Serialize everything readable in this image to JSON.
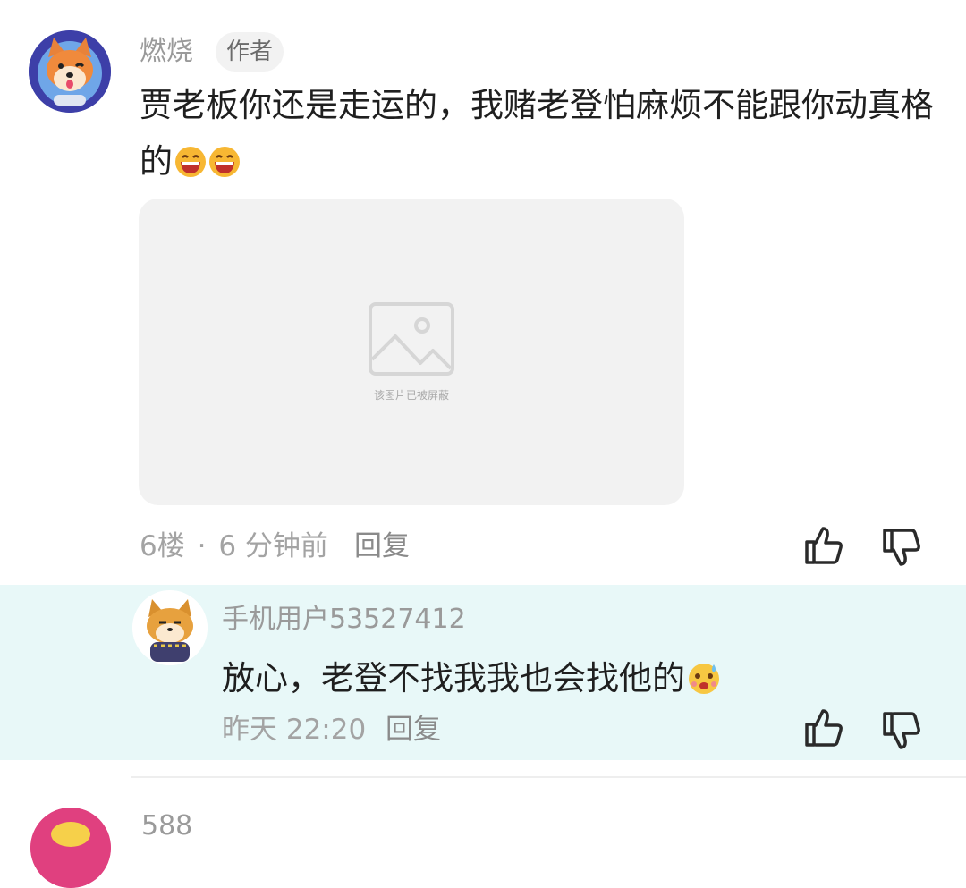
{
  "comment": {
    "username": "燃烧",
    "badge": "作者",
    "text": "贾老板你还是走运的，我赌老登怕麻烦不能跟你动真格的",
    "emojis": [
      "laughing-emoji",
      "laughing-emoji"
    ],
    "blocked_image_text": "该图片已被屏蔽",
    "floor": "6楼",
    "separator": "·",
    "time": "6 分钟前",
    "reply_label": "回复",
    "like_icon": "thumbs-up-icon",
    "dislike_icon": "thumbs-down-icon"
  },
  "reply": {
    "username": "手机用户53527412",
    "text": "放心，老登不找我我也会找他的",
    "emoji": "sweating-emoji",
    "time": "昨天 22:20",
    "reply_label": "回复"
  },
  "next_comment": {
    "username": "588"
  },
  "colors": {
    "reply_bg": "#e8f8f8",
    "text": "#1f1f1f",
    "meta": "#a3a3a3",
    "avatar_ring": "#3d3fa8",
    "next_avatar": "#e0407f"
  }
}
